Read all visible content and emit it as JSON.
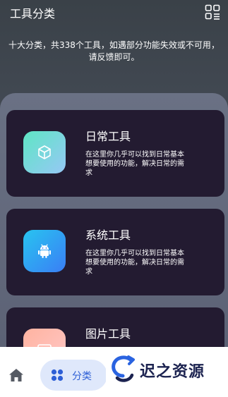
{
  "header": {
    "title": "工具分类",
    "menu_icon": "grid-icon"
  },
  "subtitle": "十大分类，共338个工具，如遇部分功能失效或不可用，请反馈即可。",
  "cards": [
    {
      "title": "日常工具",
      "description": "在这里你几乎可以找到日常基本想要使用的功能，解决日常的需求",
      "icon": "cube-icon",
      "gradient": [
        "#5ee6c4",
        "#96c8f5"
      ]
    },
    {
      "title": "系统工具",
      "description": "在这里你几乎可以找到日常基本想要使用的功能，解决日常的需求",
      "icon": "android-icon",
      "gradient": [
        "#28c4f0",
        "#3a7ef5"
      ]
    },
    {
      "title": "图片工具",
      "description": "",
      "icon": "image-icon",
      "gradient": [
        "#ffb3a0",
        "#ffc8c8"
      ]
    }
  ],
  "bottom_nav": {
    "home_icon": "home-icon",
    "category_label": "分类",
    "category_icon": "category-dots-icon"
  },
  "watermark": {
    "text": "迟之资源"
  },
  "colors": {
    "card_bg": "#231b31",
    "accent": "#2e5fd6",
    "pill_bg": "#dfe8fb"
  }
}
